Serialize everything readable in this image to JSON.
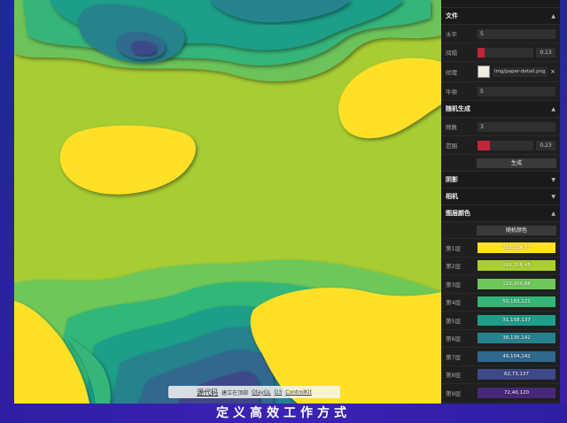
{
  "caption": "定义高效工作方式",
  "footer": {
    "source_label": "源代码",
    "text": "建立在顶部",
    "link1": "OlayGL",
    "link2": "D3",
    "link3": "ControlKit"
  },
  "panel": {
    "folder_file": "文件",
    "rows_top": [
      {
        "label": "水平",
        "value": "5"
      },
      {
        "label": "间隔",
        "value": "0.13",
        "fill": 0.13
      },
      {
        "label": "纹理",
        "value": "img/paper-detail.png",
        "close": "×"
      },
      {
        "label": "牛顿",
        "value": "5"
      }
    ],
    "folder_random": "随机生成",
    "rows_random": [
      {
        "label": "频数",
        "value": "3"
      },
      {
        "label": "范围",
        "value": "0.23",
        "fill": 0.23
      }
    ],
    "generate_button": "生成",
    "folder_shadow": "阴影",
    "folder_camera": "相机",
    "folder_color": "图层颜色",
    "randomize_button": "随机颜色",
    "layers": [
      {
        "label": "第1层",
        "value": "255,224,37",
        "color": "#ffe025"
      },
      {
        "label": "第2层",
        "value": "169,208,45",
        "color": "#a9d02d"
      },
      {
        "label": "第3层",
        "value": "110,200,88",
        "color": "#6ec858"
      },
      {
        "label": "第4层",
        "value": "50,183,121",
        "color": "#32b779"
      },
      {
        "label": "第5层",
        "value": "31,158,137",
        "color": "#1f9e89"
      },
      {
        "label": "第6层",
        "value": "38,130,142",
        "color": "#26828e"
      },
      {
        "label": "第7层",
        "value": "49,104,142",
        "color": "#31688e"
      },
      {
        "label": "第8层",
        "value": "62,73,137",
        "color": "#3e4989"
      },
      {
        "label": "第9层",
        "value": "72,40,120",
        "color": "#482878"
      }
    ],
    "caret_icon": "caret-down-icon"
  }
}
